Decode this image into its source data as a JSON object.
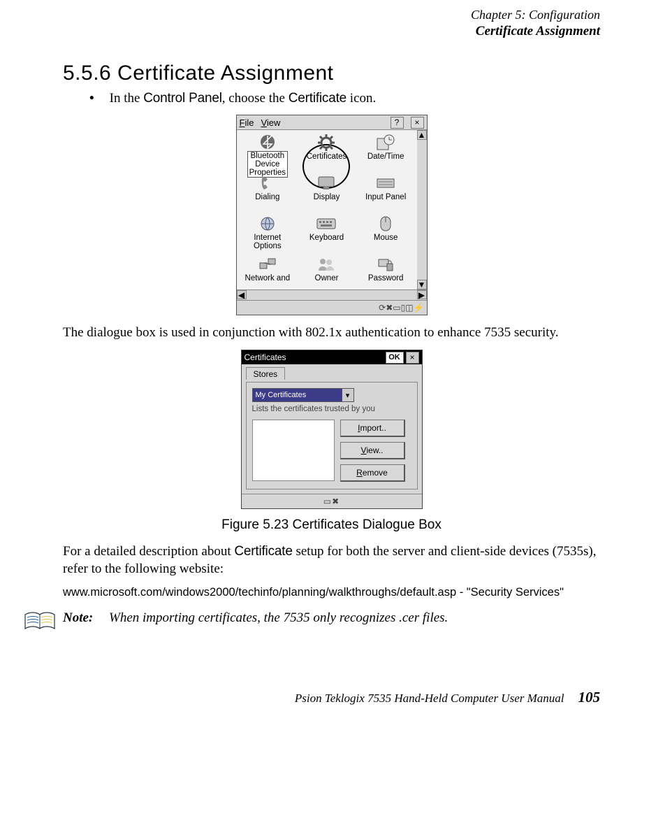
{
  "header": {
    "chapter": "Chapter 5: Configuration",
    "section": "Certificate Assignment"
  },
  "heading": "5.5.6   Certificate Assignment",
  "bullet": {
    "prefix": "In the ",
    "bold1": "Control Panel",
    "mid": ", choose the ",
    "bold2": "Certificate",
    "suffix": " icon."
  },
  "control_panel": {
    "menu_file": "File",
    "menu_view": "View",
    "help": "?",
    "close": "×",
    "scroll_up": "▲",
    "scroll_down": "▼",
    "scroll_left": "◀",
    "scroll_right": "▶",
    "items": [
      {
        "label": "Bluetooth Device Properties"
      },
      {
        "label": "Certificates"
      },
      {
        "label": "Date/Time"
      },
      {
        "label": "Dialing"
      },
      {
        "label": "Display"
      },
      {
        "label": "Input Panel"
      },
      {
        "label": "Internet Options"
      },
      {
        "label": "Keyboard"
      },
      {
        "label": "Mouse"
      },
      {
        "label": "Network and"
      },
      {
        "label": "Owner"
      },
      {
        "label": "Password"
      }
    ],
    "tray_glyphs": "⟳✖▭▯◫⚡"
  },
  "para1": "The dialogue box is used in conjunction with 802.1x authentication to enhance 7535 security.",
  "cert_dialog": {
    "title": "Certificates",
    "ok": "OK",
    "close": "×",
    "tab": "Stores",
    "combo": "My Certificates",
    "combo_arrow": "▾",
    "lists_label": "Lists the certificates trusted by you",
    "buttons": {
      "import": "Import..",
      "view": "View..",
      "remove": "Remove"
    },
    "footer_glyphs": "▭✖"
  },
  "caption": "Figure 5.23 Certificates Dialogue Box",
  "para2_prefix": "For a detailed description about ",
  "para2_bold": "Certificate",
  "para2_suffix": " setup for both the server and client-side devices (7535s), refer to the following website:",
  "url": "www.microsoft.com/windows2000/techinfo/planning/walkthroughs/default.asp - \"Security Services\"",
  "note": {
    "label": "Note:",
    "text": "When importing certificates, the 7535 only recognizes .cer files."
  },
  "footer": {
    "title": "Psion Teklogix 7535 Hand-Held Computer User Manual",
    "page": "105"
  }
}
